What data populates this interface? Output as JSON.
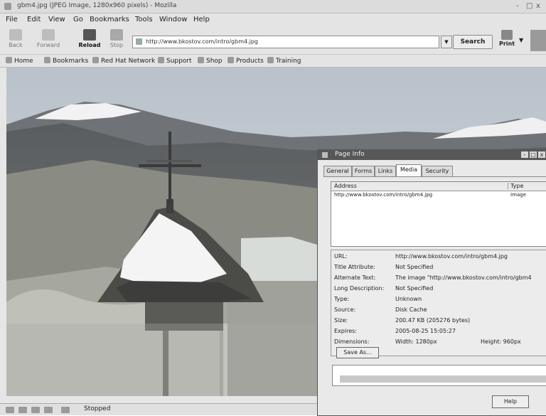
{
  "window": {
    "title": "gbm4.jpg (JPEG Image, 1280x960 pixels) - Mozilla",
    "controls": [
      "-",
      "□",
      "x"
    ]
  },
  "menu": [
    "File",
    "Edit",
    "View",
    "Go",
    "Bookmarks",
    "Tools",
    "Window",
    "Help"
  ],
  "toolbar": {
    "buttons": [
      {
        "label": "Back",
        "icon": "back-arrow-icon"
      },
      {
        "label": "Forward",
        "icon": "forward-arrow-icon"
      },
      {
        "label": "Reload",
        "icon": "reload-icon"
      },
      {
        "label": "Stop",
        "icon": "stop-icon"
      }
    ],
    "url": "http://www.bkostov.com/intro/gbm4.jpg",
    "search_label": "Search",
    "print_label": "Print"
  },
  "personal_toolbar": [
    "Home",
    "Bookmarks",
    "Red Hat Network",
    "Support",
    "Shop",
    "Products",
    "Training"
  ],
  "page_info": {
    "title": "Page Info",
    "tabs": [
      "General",
      "Forms",
      "Links",
      "Media",
      "Security"
    ],
    "active_tab": "Media",
    "list_headers": [
      "Address",
      "Type"
    ],
    "list_rows": [
      {
        "address": "http://www.bkostov.com/intro/gbm4.jpg",
        "type": "Image"
      }
    ],
    "properties": [
      {
        "label": "URL:",
        "value": "http://www.bkostov.com/intro/gbm4.jpg"
      },
      {
        "label": "Title Attribute:",
        "value": "Not Specified"
      },
      {
        "label": "Alternate Text:",
        "value": "The image \"http://www.bkostov.com/intro/gbm4"
      },
      {
        "label": "Long Description:",
        "value": "Not Specified"
      },
      {
        "label": "Type:",
        "value": "Unknown"
      },
      {
        "label": "Source:",
        "value": "Disk Cache"
      },
      {
        "label": "Size:",
        "value": "200.47 KB (205276 bytes)"
      },
      {
        "label": "Expires:",
        "value": "2005-08-25 15:05:27"
      },
      {
        "label": "Dimensions:",
        "value": "Width: 1280px",
        "extra": "Height: 960px"
      }
    ],
    "save_as_label": "Save As...",
    "help_label": "Help"
  },
  "status": {
    "text": "Stopped"
  },
  "colors": {
    "dialog_titlebar": "#575757",
    "chrome": "#e4e4e4",
    "sky": "#c9d0d8"
  }
}
